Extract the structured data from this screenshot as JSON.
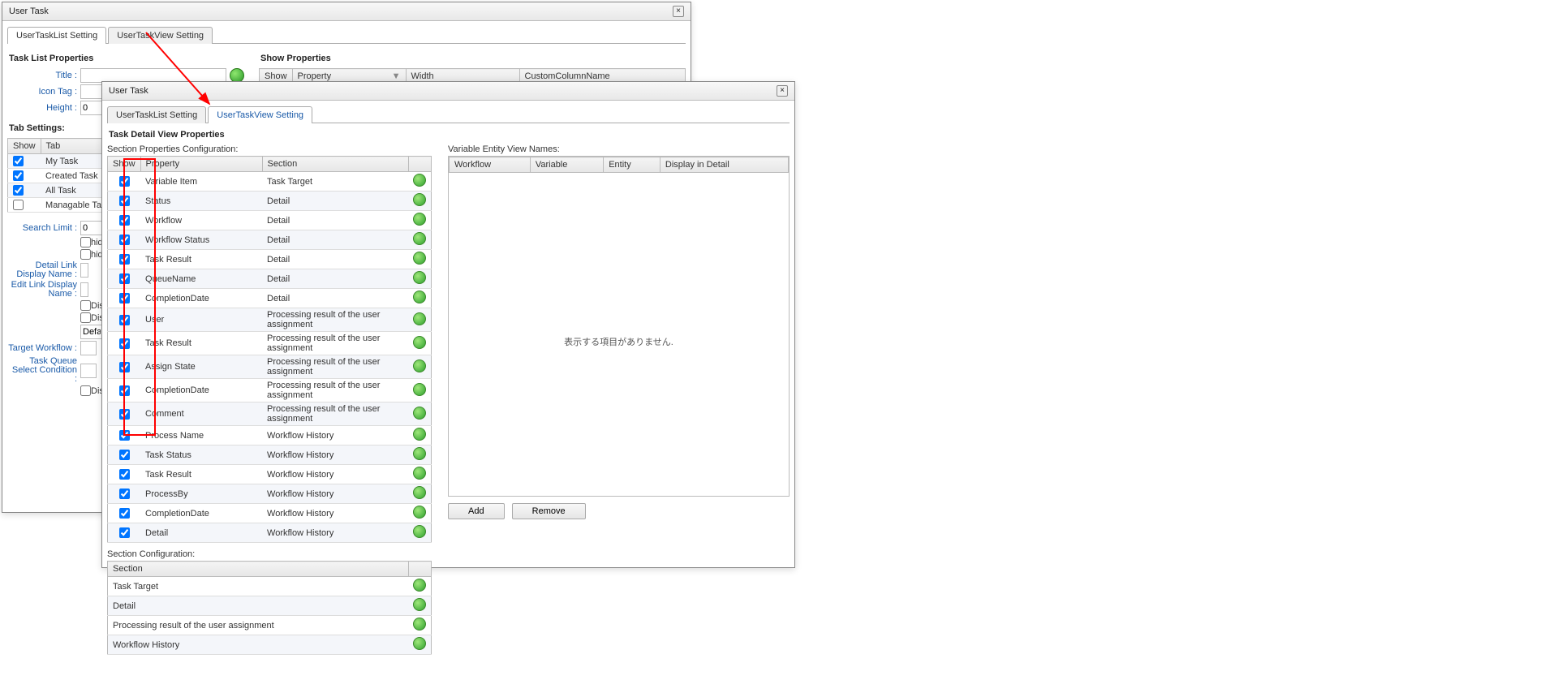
{
  "backDialog": {
    "title": "User Task",
    "tabs": [
      "UserTaskList Setting",
      "UserTaskView Setting"
    ],
    "taskListProps": {
      "heading": "Task List Properties",
      "titleLabel": "Title :",
      "iconTagLabel": "Icon Tag :",
      "heightLabel": "Height :",
      "heightVal": "0"
    },
    "showProps": {
      "heading": "Show Properties",
      "cols": {
        "show": "Show",
        "property": "Property",
        "width": "Width",
        "custom": "CustomColumnName"
      }
    },
    "tabSettings": {
      "heading": "Tab Settings:",
      "cols": {
        "show": "Show",
        "tab": "Tab"
      },
      "rows": [
        "My Task",
        "Created Task",
        "All Task",
        "Managable Task"
      ]
    },
    "searchLimitLabel": "Search Limit :",
    "searchLimitVal": "0",
    "hid1": "hid",
    "hid2": "hid",
    "detailLink": "Detail Link Display Name :",
    "editLink": "Edit Link Display Name :",
    "dis1": "Dis",
    "dis2": "Dis",
    "defau": "Defau",
    "targetWf": "Target Workflow :",
    "taskQueue": "Task Queue Select Condition :",
    "dis3": "Dis"
  },
  "frontDialog": {
    "title": "User Task",
    "tabs": [
      "UserTaskList Setting",
      "UserTaskView Setting"
    ],
    "heading": "Task Detail View Properties",
    "sectionPropsLabel": "Section Properties Configuration:",
    "propsCols": {
      "show": "Show",
      "property": "Property",
      "section": "Section"
    },
    "propsRows": [
      {
        "prop": "Variable Item",
        "section": "Task Target"
      },
      {
        "prop": "Status",
        "section": "Detail"
      },
      {
        "prop": "Workflow",
        "section": "Detail"
      },
      {
        "prop": "Workflow Status",
        "section": "Detail"
      },
      {
        "prop": "Task Result",
        "section": "Detail"
      },
      {
        "prop": "QueueName",
        "section": "Detail"
      },
      {
        "prop": "CompletionDate",
        "section": "Detail"
      },
      {
        "prop": "User",
        "section": "Processing result of the user assignment"
      },
      {
        "prop": "Task Result",
        "section": "Processing result of the user assignment"
      },
      {
        "prop": "Assign State",
        "section": "Processing result of the user assignment"
      },
      {
        "prop": "CompletionDate",
        "section": "Processing result of the user assignment"
      },
      {
        "prop": "Comment",
        "section": "Processing result of the user assignment"
      },
      {
        "prop": "Process Name",
        "section": "Workflow History"
      },
      {
        "prop": "Task Status",
        "section": "Workflow History"
      },
      {
        "prop": "Task Result",
        "section": "Workflow History"
      },
      {
        "prop": "ProcessBy",
        "section": "Workflow History"
      },
      {
        "prop": "CompletionDate",
        "section": "Workflow History"
      },
      {
        "prop": "Detail",
        "section": "Workflow History"
      }
    ],
    "sectionConfigLabel": "Section Configuration:",
    "sectionCols": {
      "section": "Section"
    },
    "sectionRows": [
      "Task Target",
      "Detail",
      "Processing result of the user assignment",
      "Workflow History"
    ],
    "variableEntity": {
      "heading": "Variable Entity View Names:",
      "cols": [
        "Workflow",
        "Variable",
        "Entity",
        "Display in Detail"
      ],
      "empty": "表示する項目がありません."
    },
    "addBtn": "Add",
    "removeBtn": "Remove"
  }
}
